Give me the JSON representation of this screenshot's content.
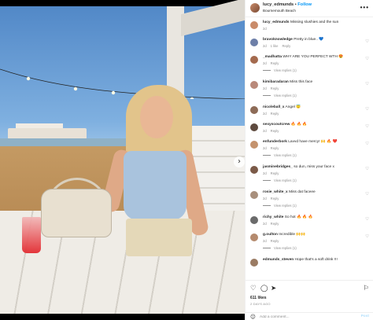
{
  "post": {
    "username": "lucy_edmunds",
    "separator": "•",
    "follow_label": "Follow",
    "location": "Bournemouth Beach",
    "more_label": "•••"
  },
  "comments": [
    {
      "user": "lucy_edmunds",
      "text": "Missing slushies and the sun",
      "meta": [
        "2d"
      ],
      "replies": null
    },
    {
      "user": "bravoknowledge",
      "text": "Pretty in blue.. 💙",
      "meta": [
        "2d",
        "1 like",
        "Reply"
      ],
      "replies": null
    },
    {
      "user": "_madhatta",
      "text": "WHY ARE YOU PERFECT WTH 😍",
      "meta": [
        "2d",
        "Reply"
      ],
      "replies": "View replies (1)"
    },
    {
      "user": "kimibaradaran",
      "text": "Miss this face",
      "meta": [
        "2d",
        "Reply"
      ],
      "replies": "View replies (1)"
    },
    {
      "user": "nicoleball_x",
      "text": "Angel 😇",
      "meta": [
        "2d",
        "Reply"
      ],
      "replies": null
    },
    {
      "user": "sexyscoutcrew",
      "text": "🔥 🔥 🔥",
      "meta": [
        "2d",
        "Reply"
      ],
      "replies": null
    },
    {
      "user": "enfunderbork",
      "text": "Lavvd have mercy! 🙌 🔥 ❤️",
      "meta": [
        "2d",
        "Reply"
      ],
      "replies": "View replies (1)"
    },
    {
      "user": "jasminebridges_",
      "text": "so dun, miss your face x",
      "meta": [
        "2d",
        "Reply"
      ],
      "replies": "View replies (1)"
    },
    {
      "user": "rosie_white_x",
      "text": "Miss dat faceee",
      "meta": [
        "2d",
        "Reply"
      ],
      "replies": "View replies (1)"
    },
    {
      "user": "richy_white",
      "text": "So hot 🔥 🔥 🔥",
      "meta": [
        "2d",
        "Reply"
      ],
      "replies": null
    },
    {
      "user": "g.oulton",
      "text": "Incredible 🙌🙌",
      "meta": [
        "2d",
        "Reply"
      ],
      "replies": "View replies (1)"
    },
    {
      "user": "edmunds_steven",
      "text": "Hope that's a soft drink !!!",
      "meta": [],
      "replies": null
    }
  ],
  "icons": {
    "like": "heart-outline-icon",
    "comment": "comment-bubble-icon",
    "share": "paper-plane-icon",
    "save": "bookmark-icon",
    "emoji": "smiley-icon",
    "carousel_next": "chevron-right-icon",
    "comment_like": "small-heart-icon"
  },
  "glyphs": {
    "like": "♡",
    "comment": "◯",
    "share": "➤",
    "save": "⚐",
    "emoji": "☺",
    "next": "›",
    "comment_heart": "♡"
  },
  "engagement": {
    "likes": "611 likes",
    "date": "2 DAYS AGO"
  },
  "composer": {
    "placeholder": "Add a comment...",
    "post_label": "Post"
  },
  "colors": {
    "accent": "#0095f6",
    "muted": "#8e8e8e",
    "post_disabled": "#b2dffc"
  }
}
